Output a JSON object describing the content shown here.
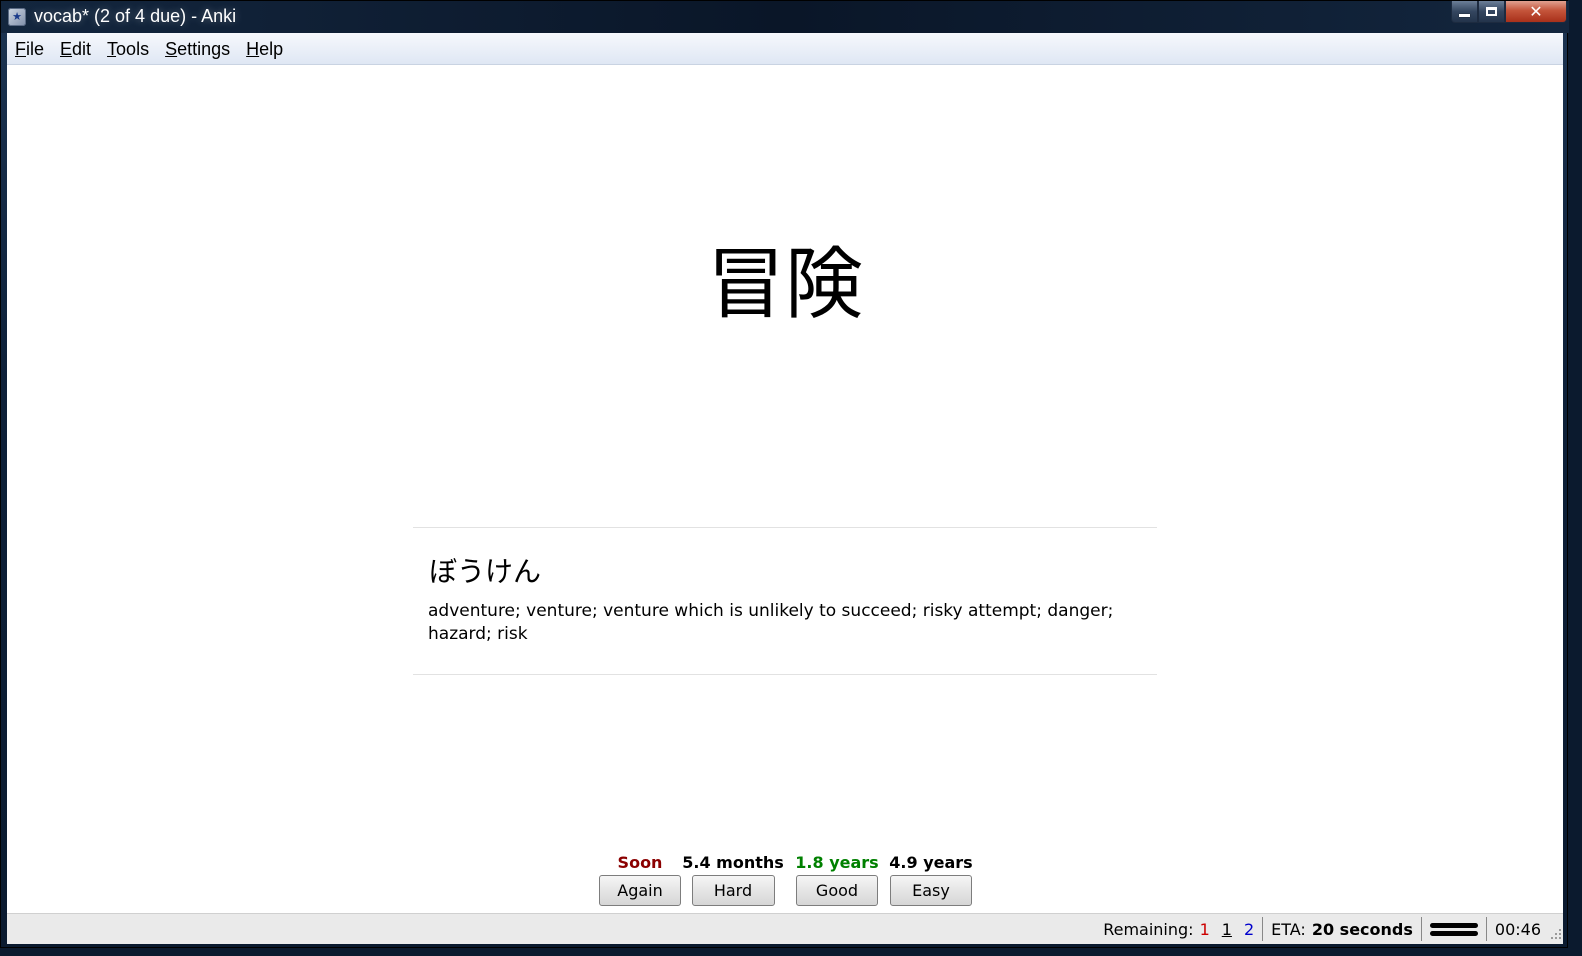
{
  "window": {
    "title": "vocab* (2 of 4 due) - Anki",
    "icon": "anki-star-icon"
  },
  "menu": {
    "items": [
      {
        "label": "File"
      },
      {
        "label": "Edit"
      },
      {
        "label": "Tools"
      },
      {
        "label": "Settings"
      },
      {
        "label": "Help"
      }
    ]
  },
  "card": {
    "front": "冒険",
    "reading": "ぼうけん",
    "meaning": "adventure; venture; venture which is unlikely to succeed; risky attempt; danger; hazard; risk"
  },
  "answers": [
    {
      "interval": "Soon",
      "label": "Again",
      "color": "#8b0000"
    },
    {
      "interval": "5.4 months",
      "label": "Hard",
      "color": "#000000"
    },
    {
      "interval": "1.8 years",
      "label": "Good",
      "color": "#008000"
    },
    {
      "interval": "4.9 years",
      "label": "Easy",
      "color": "#000000"
    }
  ],
  "status": {
    "remaining_label": "Remaining:",
    "new_count": "1",
    "learning_count": "1",
    "review_count": "2",
    "eta_label": "ETA:",
    "eta_value": "20 seconds",
    "timer": "00:46",
    "colors": {
      "new": "#cc0000",
      "learning": "#000000",
      "review": "#0000cc"
    }
  }
}
